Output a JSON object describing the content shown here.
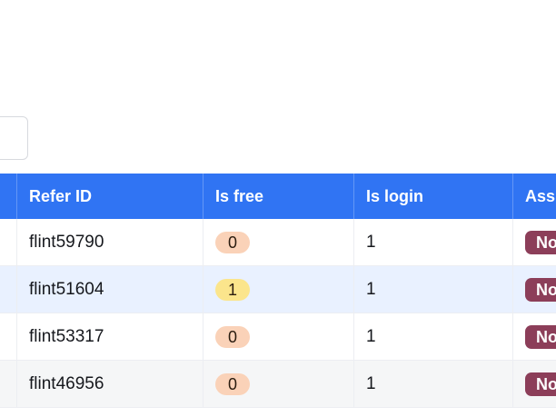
{
  "table": {
    "headers": {
      "refer_id": "Refer ID",
      "is_free": "Is free",
      "is_login": "Is login",
      "assigned": "Ass"
    },
    "rows": [
      {
        "refer_id": "flint59790",
        "is_free": "0",
        "is_login": "1",
        "tag": "No"
      },
      {
        "refer_id": "flint51604",
        "is_free": "1",
        "is_login": "1",
        "tag": "No"
      },
      {
        "refer_id": "flint53317",
        "is_free": "0",
        "is_login": "1",
        "tag": "No"
      },
      {
        "refer_id": "flint46956",
        "is_free": "0",
        "is_login": "1",
        "tag": "No"
      }
    ]
  },
  "colors": {
    "header_bg": "#3074f3",
    "highlight_row": "#e9f1ff",
    "alt_row": "#f5f6f7",
    "badge_zero": "#fad2b8",
    "badge_one": "#fbe58c",
    "tag_bg": "#8c3e59"
  }
}
